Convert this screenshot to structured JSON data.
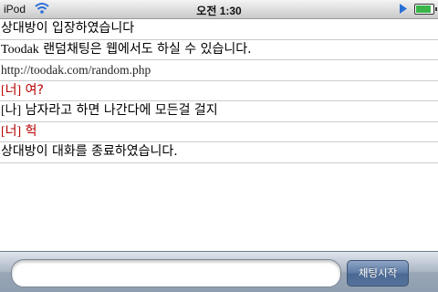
{
  "status_bar": {
    "carrier": "iPod",
    "wifi_icon": "wifi-icon",
    "time": "오전 1:30",
    "play_icon": "play-icon",
    "battery_icon": "battery-icon",
    "battery_level": 0.9
  },
  "messages": [
    {
      "text": "상대방이 입장하였습니다"
    },
    {
      "prefix": "Toodak",
      "text": " 랜덤채팅은 웹에서도 하실 수 있습니다."
    },
    {
      "text": "http://toodak.com/random.php"
    },
    {
      "tag": "[너]",
      "text": " 여?"
    },
    {
      "tag": "[나]",
      "text": " 남자라고 하면 나간다에 모든걸 걸지"
    },
    {
      "tag": "[너]",
      "text": " 헉"
    },
    {
      "text": "상대방이 대화를 종료하였습니다."
    }
  ],
  "toolbar": {
    "input_value": "",
    "start_button": "채팅시작"
  },
  "colors": {
    "partner_text": "#b50000",
    "toolbar_blue": "#5c79a3"
  }
}
